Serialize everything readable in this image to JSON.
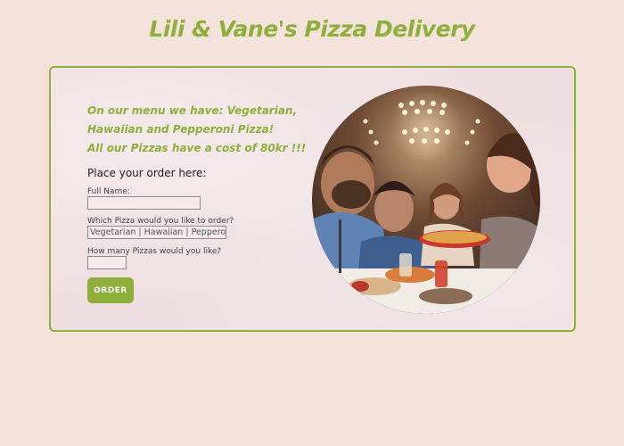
{
  "header": {
    "title": "Lili & Vane's Pizza Delivery"
  },
  "menu": {
    "line1": "On our menu we have: Vegetarian, Hawaiian and Pepperoni Pizza!",
    "line2": "All our Pizzas have a cost of 80kr !!!"
  },
  "form": {
    "heading": "Place your order here:",
    "full_name_label": "Full Name:",
    "full_name_value": "",
    "pizza_label": "Which Pizza would you like to order?",
    "pizza_value": "Vegetarian | Hawaiian | Pepperoni",
    "quantity_label": "How many Pizzas would you like?",
    "quantity_value": "",
    "order_button": "ORDER"
  },
  "image": {
    "name": "friends-eating-pizza-photo"
  },
  "colors": {
    "accent": "#8fae3b",
    "background": "#f3e3da",
    "panel": "#efdfe1"
  }
}
